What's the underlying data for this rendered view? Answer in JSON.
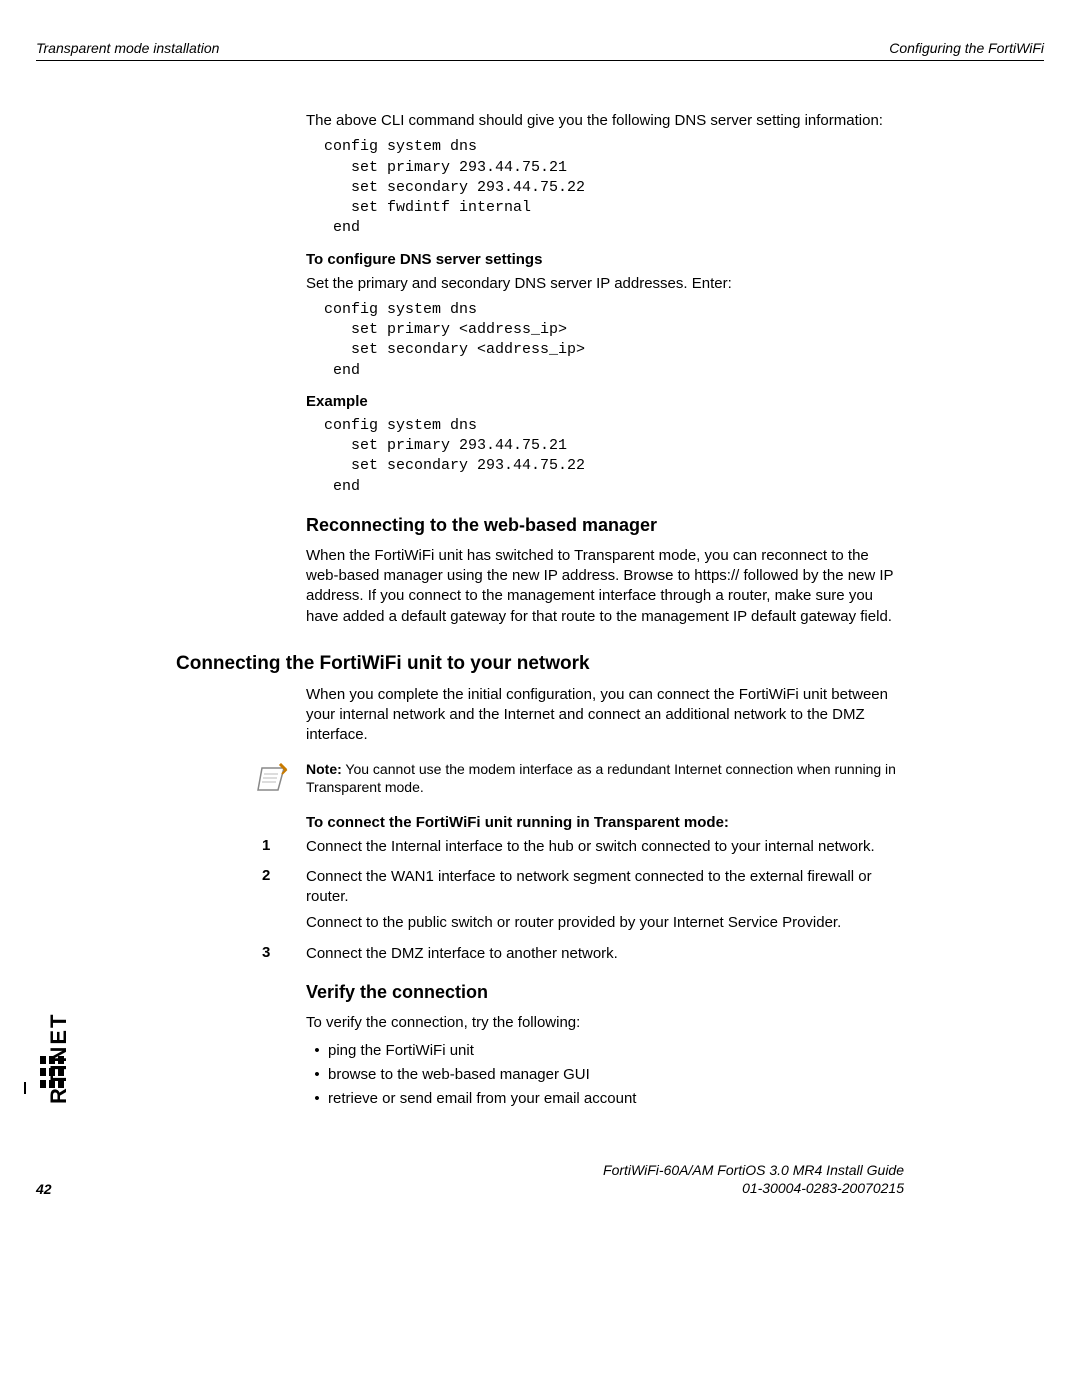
{
  "header": {
    "left": "Transparent mode installation",
    "right": "Configuring the FortiWiFi"
  },
  "intro": "The above CLI command should give you the following DNS server setting information:",
  "cli1": "  config system dns\n     set primary 293.44.75.21\n     set secondary 293.44.75.22\n     set fwdintf internal\n   end",
  "h_config_dns": "To configure DNS server settings",
  "p_config_dns": "Set the primary and secondary DNS server IP addresses. Enter:",
  "cli2": "  config system dns\n     set primary <address_ip>\n     set secondary <address_ip>\n   end",
  "h_example": "Example",
  "cli3": "  config system dns\n     set primary 293.44.75.21\n     set secondary 293.44.75.22\n   end",
  "h_reconnect": "Reconnecting to the web-based manager",
  "p_reconnect": "When the FortiWiFi unit has switched to Transparent mode, you can reconnect to the web-based manager using the new IP address. Browse to https:// followed by the new IP address. If you connect to the management interface through a router, make sure you have added a default gateway for that route to the management IP default gateway field.",
  "h_connect": "Connecting the FortiWiFi unit to your network",
  "p_connect": "When you complete the initial configuration, you can connect the FortiWiFi unit between your internal network and the Internet and connect an additional network to the DMZ interface.",
  "note_label": "Note:",
  "note_body": " You cannot use the modem interface as a redundant Internet connection when running in Transparent mode.",
  "h_connect_steps": "To connect the FortiWiFi unit running in Transparent mode:",
  "steps": {
    "n1": "1",
    "s1": "Connect the Internal interface to the hub or switch connected to your internal network.",
    "n2": "2",
    "s2a": "Connect the WAN1 interface to network segment connected to the external firewall or router.",
    "s2b": "Connect to the public switch or router provided by your Internet Service Provider.",
    "n3": "3",
    "s3": "Connect the DMZ interface to another network."
  },
  "h_verify": "Verify the connection",
  "p_verify": "To verify the connection, try the following:",
  "bullets": {
    "b1": "ping the FortiWiFi unit",
    "b2": "browse to the web-based manager GUI",
    "b3": "retrieve or send email from your email account"
  },
  "footer": {
    "page": "42",
    "guide": "FortiWiFi-60A/AM FortiOS 3.0 MR4 Install Guide",
    "docnum": "01-30004-0283-20070215"
  },
  "logo_text": "RTINET"
}
